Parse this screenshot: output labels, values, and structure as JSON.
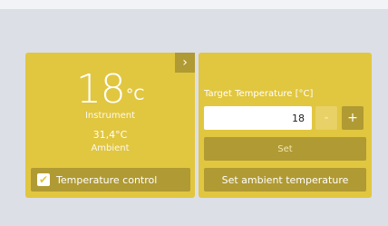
{
  "instrument": {
    "temperature": "18",
    "unit": "°C",
    "label": "Instrument",
    "ambient_value": "31,4°C",
    "ambient_label": "Ambient"
  },
  "temperature_control": {
    "label": "Temperature control",
    "checked": true
  },
  "target": {
    "label": "Target Temperature [°C]",
    "value": "18",
    "minus_label": "-",
    "plus_label": "+",
    "set_label": "Set",
    "set_ambient_label": "Set ambient temperature"
  },
  "icons": {
    "expand": "chevron-right-icon",
    "check": "checkmark-icon"
  },
  "colors": {
    "panel": "#e1c640",
    "button": "#b09a33",
    "background": "#dcdfe6"
  }
}
